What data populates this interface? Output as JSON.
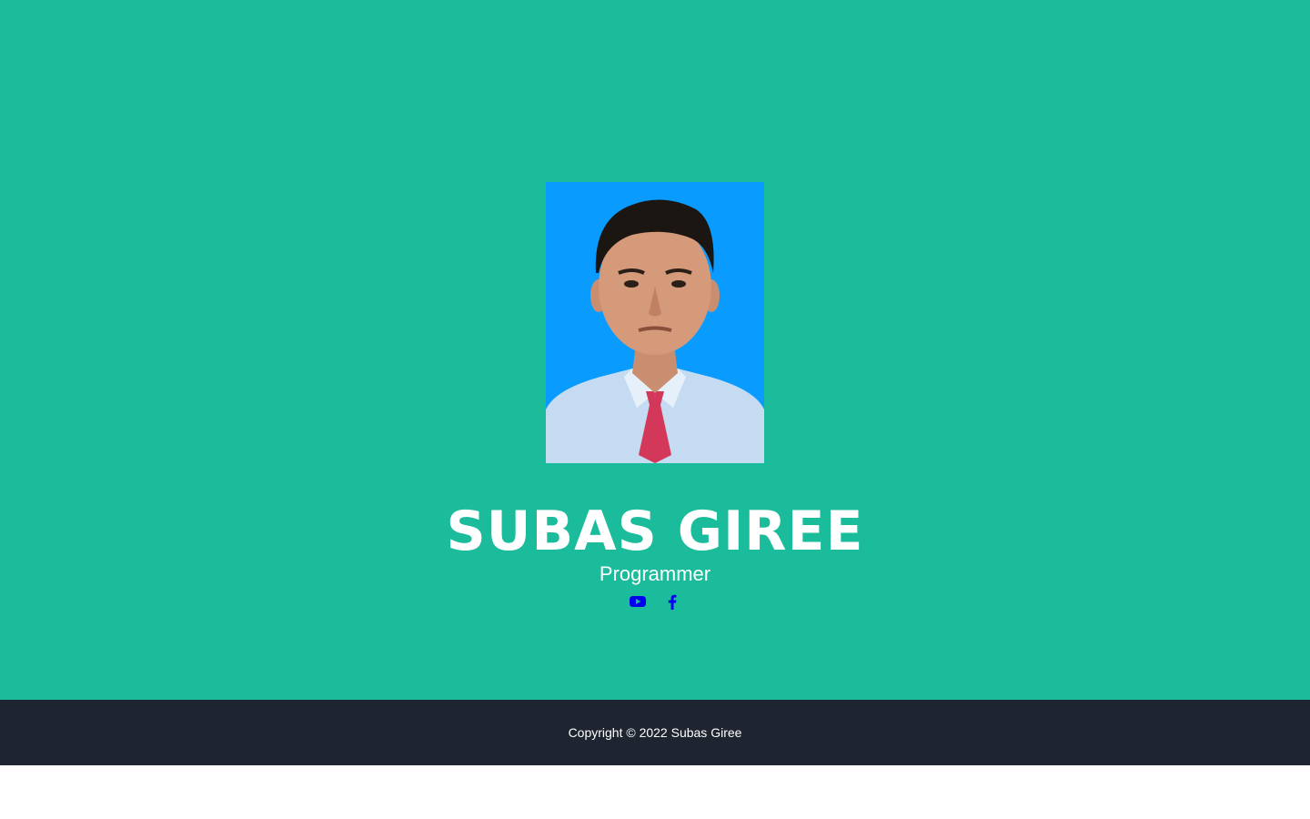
{
  "profile": {
    "name": "SUBAS GIREE",
    "role": "Programmer"
  },
  "social": [
    {
      "icon": "youtube-icon"
    },
    {
      "icon": "facebook-icon"
    }
  ],
  "footer": {
    "copyright": "Copyright © 2022 Subas Giree"
  },
  "colors": {
    "hero_background": "#1abc9c",
    "footer_background": "#1e2430",
    "photo_background": "#0a9bff",
    "icon_color": "#0000ee",
    "text_color": "#ffffff"
  }
}
